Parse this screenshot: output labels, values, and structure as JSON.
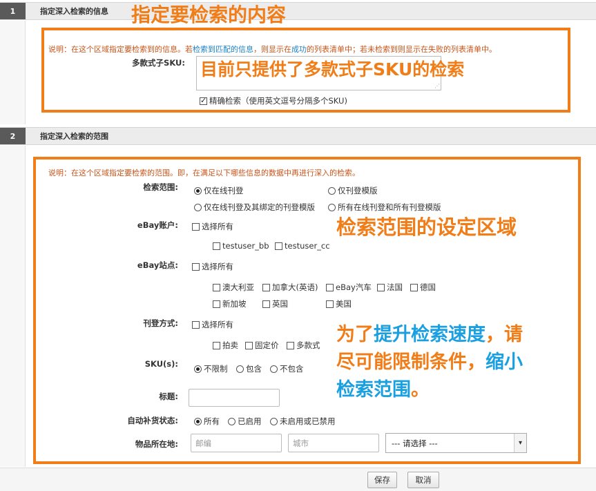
{
  "section1": {
    "number": "1",
    "title": "指定深入检索的信息",
    "annotation": "指定要检索的内容",
    "note_prefix": "说明：在这个区域指定要检索到的信息。若",
    "note_link": "检索到匹配的信息",
    "note_mid": "，则显示在",
    "note_ok": "成功",
    "note_suffix": "的列表清单中；若未检索到则显示在失败的列表清单中。",
    "sku_label": "多款式子SKU:",
    "sku_annotation": "目前只提供了多款式子SKU的检索",
    "exact_label": "精确检索（使用英文逗号分隔多个SKU)"
  },
  "section2": {
    "number": "2",
    "title": "指定深入检索的范围",
    "note": "说明：在这个区域指定要检索的范围。即，在满足以下哪些信息的数据中再进行深入的检索。",
    "annotation_range": "检索范围的设定区域",
    "annotation_speed": {
      "p1": "为了",
      "p2": "提升检索速度",
      "p3": "，请",
      "p4": "尽可能限制条件",
      "p5": "，",
      "p6": "缩小",
      "p7": "检索范围",
      "p8": "。"
    },
    "scope": {
      "label": "检索范围:",
      "options": [
        "仅在线刊登",
        "仅刊登模版",
        "仅在线刊登及其绑定的刊登模版",
        "所有在线刊登和所有刊登模版"
      ]
    },
    "ebay_account": {
      "label": "eBay账户:",
      "select_all": "选择所有",
      "options": [
        "testuser_bb",
        "testuser_cc"
      ]
    },
    "ebay_site": {
      "label": "eBay站点:",
      "select_all": "选择所有",
      "options": [
        "澳大利亚",
        "加拿大(英语)",
        "eBay汽车",
        "法国",
        "德国",
        "新加坡",
        "英国",
        "美国"
      ]
    },
    "listing_type": {
      "label": "刊登方式:",
      "select_all": "选择所有",
      "options": [
        "拍卖",
        "固定价",
        "多款式"
      ]
    },
    "sku": {
      "label": "SKU(s):",
      "options": [
        "不限制",
        "包含",
        "不包含"
      ]
    },
    "title_field": {
      "label": "标题:",
      "value": ""
    },
    "restock": {
      "label": "自动补货状态:",
      "options": [
        "所有",
        "已启用",
        "未启用或已禁用"
      ]
    },
    "location": {
      "label": "物品所在地:",
      "zip_placeholder": "邮编",
      "city_placeholder": "城市",
      "country_selected": "--- 请选择 ---"
    }
  },
  "footer": {
    "save": "保存",
    "cancel": "取消"
  },
  "colors": {
    "annotation_orange": "#f07d18",
    "annotation_blue": "#1a9fe0"
  }
}
